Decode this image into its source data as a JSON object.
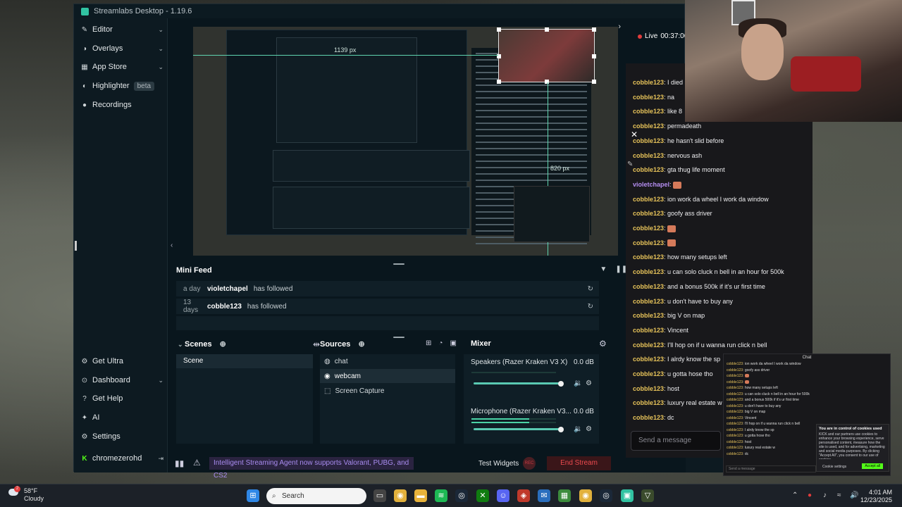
{
  "window": {
    "title": "Streamlabs Desktop - 1.19.6"
  },
  "sidebar": {
    "items": [
      {
        "label": "Editor",
        "icon": "edit-icon",
        "chevron": true
      },
      {
        "label": "Overlays",
        "icon": "overlay-icon",
        "chevron": true
      },
      {
        "label": "App Store",
        "icon": "store-icon",
        "chevron": true
      },
      {
        "label": "Highlighter",
        "icon": "highlighter-icon",
        "badge": "beta"
      },
      {
        "label": "Recordings",
        "icon": "record-icon"
      }
    ],
    "bottom_items": [
      {
        "label": "Get Ultra",
        "icon": "ultra-icon"
      },
      {
        "label": "Dashboard",
        "icon": "dashboard-icon",
        "chevron": true
      },
      {
        "label": "Get Help",
        "icon": "help-icon"
      },
      {
        "label": "AI",
        "icon": "ai-icon"
      },
      {
        "label": "Settings",
        "icon": "settings-icon"
      }
    ],
    "user": {
      "name": "chromezerohd"
    }
  },
  "preview": {
    "label_top": "1139 px",
    "label_right": "820 px"
  },
  "mini_feed": {
    "title": "Mini Feed",
    "rows": [
      {
        "ago": "a day",
        "user": "violetchapel",
        "action": "has followed"
      },
      {
        "ago": "13 days",
        "user": "cobble123",
        "action": "has followed"
      }
    ]
  },
  "scenes": {
    "title": "Scenes",
    "items": [
      "Scene"
    ]
  },
  "sources": {
    "title": "Sources",
    "items": [
      {
        "label": "chat",
        "icon": "globe-icon"
      },
      {
        "label": "webcam",
        "icon": "camera-icon",
        "selected": true
      },
      {
        "label": "Screen Capture",
        "icon": "screen-capture-icon"
      }
    ]
  },
  "mixer": {
    "title": "Mixer",
    "channels": [
      {
        "name": "Speakers (Razer Kraken V3 X)",
        "db": "0.0 dB",
        "level": 0.85
      },
      {
        "name": "Microphone (Razer Kraken V3...",
        "db": "0.0 dB",
        "level": 0.85
      }
    ]
  },
  "footer": {
    "banner": "Intelligent Streaming Agent now supports Valorant, PUBG, and CS2",
    "test_widgets": "Test Widgets",
    "rec": "REC",
    "end_stream": "End Stream"
  },
  "live": {
    "label": "Live",
    "time": "00:37:06"
  },
  "chat": {
    "messages": [
      {
        "user": "cobble123",
        "text": "I died"
      },
      {
        "user": "cobble123",
        "text": "na"
      },
      {
        "user": "cobble123",
        "text": "like 8"
      },
      {
        "user": "cobble123",
        "text": "permadeath"
      },
      {
        "user": "cobble123",
        "text": "he hasn't slid before"
      },
      {
        "user": "cobble123",
        "text": "nervous ash"
      },
      {
        "user": "cobble123",
        "text": "gta thug life moment"
      },
      {
        "user": "violetchapel",
        "text": "",
        "emote": true
      },
      {
        "user": "cobble123",
        "text": "ion work da wheel I work da window"
      },
      {
        "user": "cobble123",
        "text": "goofy ass driver"
      },
      {
        "user": "cobble123",
        "text": "",
        "emote": true
      },
      {
        "user": "cobble123",
        "text": "",
        "emote": true
      },
      {
        "user": "cobble123",
        "text": "how many setups left"
      },
      {
        "user": "cobble123",
        "text": "u can solo cluck n bell in an hour for 500k"
      },
      {
        "user": "cobble123",
        "text": "and a bonus 500k if it's ur first time"
      },
      {
        "user": "cobble123",
        "text": "u don't have to buy any"
      },
      {
        "user": "cobble123",
        "text": "big V on map"
      },
      {
        "user": "cobble123",
        "text": "Vincent"
      },
      {
        "user": "cobble123",
        "text": "I'll hop on if u wanna run click n bell"
      },
      {
        "user": "cobble123",
        "text": "I alrdy know the sp"
      },
      {
        "user": "cobble123",
        "text": "u gotta hose tho"
      },
      {
        "user": "cobble123",
        "text": "host"
      },
      {
        "user": "cobble123",
        "text": "luxury real estate w"
      },
      {
        "user": "cobble123",
        "text": "dc"
      }
    ],
    "send_placeholder": "Send a message"
  },
  "popup": {
    "title": "Chat",
    "send_placeholder": "Send a message",
    "cookie_title": "You are in control of cookies used",
    "cookie_text": "KICK and our partners use cookies to enhance your browsing experience, serve personalised content, measure how the site is used, and for advertising, marketing and social media purposes. By clicking \"Accept All\", you consent to our use of cookies.",
    "cookie_settings": "Cookie settings",
    "accept_all": "Accept all"
  },
  "taskbar": {
    "weather_temp": "58°F",
    "weather_desc": "Cloudy",
    "weather_badge": "2",
    "search_placeholder": "Search",
    "time": "4:01 AM",
    "date": "12/23/2025"
  },
  "colors": {
    "accent": "#31c3a2",
    "end_stream": "#ec4a4f",
    "chat_user": "#e7c35a",
    "chat_user_alt": "#b48df0"
  }
}
